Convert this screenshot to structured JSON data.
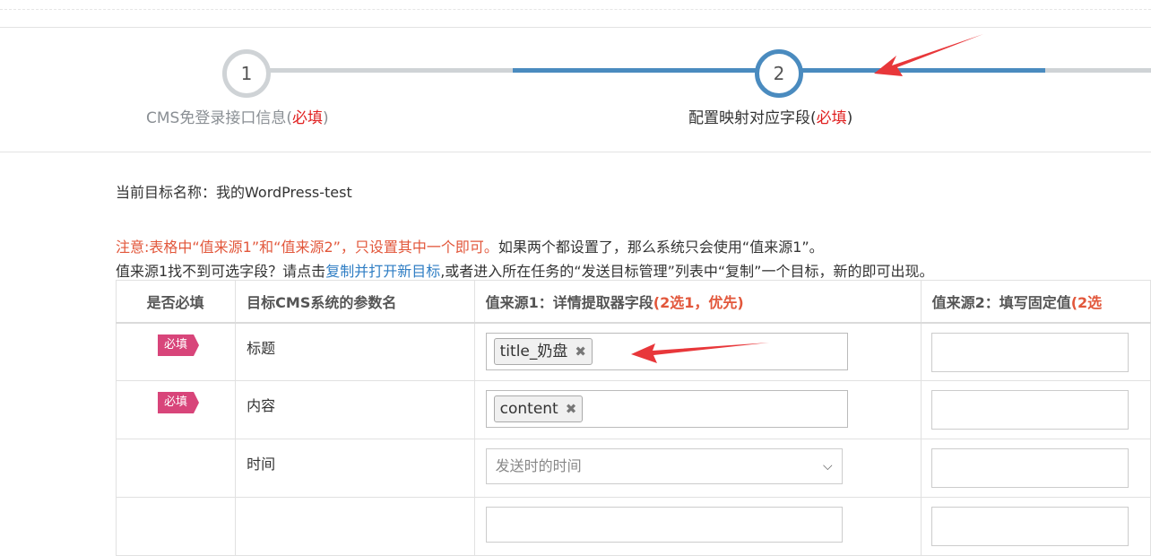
{
  "steps": [
    {
      "number": "1",
      "title": "CMS免登录接口信息",
      "open": "(",
      "required": "必填",
      "close": ")"
    },
    {
      "number": "2",
      "title": "配置映射对应字段",
      "open": "(",
      "required": "必填",
      "close": ")"
    }
  ],
  "target": {
    "label": "当前目标名称：",
    "name": "我的WordPress-test"
  },
  "notice": {
    "red_text": "注意:表格中“值来源1”和“值来源2”，只设置其中一个即可。",
    "text": "如果两个都设置了，那么系统只会使用“值来源1”。",
    "line2_before": "值来源1找不到可选字段？请点击",
    "line2_link": "复制并打开新目标",
    "line2_after": ",或者进入所在任务的“发送目标管理”列表中“复制”一个目标，新的即可出现。"
  },
  "table": {
    "headers": {
      "required": "是否必填",
      "param": "目标CMS系统的参数名",
      "source1": "值来源1：详情提取器字段",
      "source1_note": "(2选1，优先)",
      "source2": "值来源2：填写固定值",
      "source2_note": "(2选"
    },
    "rows": [
      {
        "badge": "必填",
        "param": "标题",
        "tag": "title_奶盘",
        "tag_remove": "✖"
      },
      {
        "badge": "必填",
        "param": "内容",
        "tag": "content",
        "tag_remove": "✖"
      },
      {
        "badge": "",
        "param": "时间",
        "select_placeholder": "发送时的时间",
        "select_chevron": "⌵"
      }
    ]
  },
  "colors": {
    "active": "#4a8bbf",
    "inactive": "#cfd3d6",
    "arrow": "#e8373a",
    "badge": "#d8457a"
  }
}
